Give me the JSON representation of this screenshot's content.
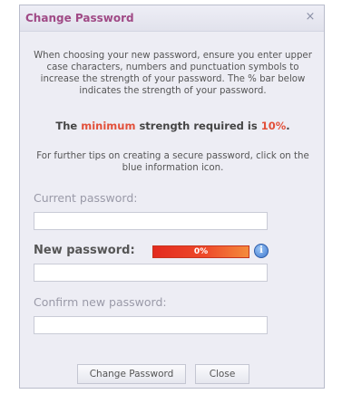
{
  "dialog": {
    "title": "Change Password",
    "close_glyph": "×",
    "intro_text": "When choosing your new password, ensure you enter upper case characters, numbers and punctuation symbols to increase the strength of your password. The % bar below indicates the strength of your password.",
    "strength_prefix": "The",
    "strength_word": "minimum",
    "strength_middle": "strength required is",
    "strength_value": "10%",
    "strength_suffix": ".",
    "tips_text": "For further tips on creating a secure password, click on the blue information icon."
  },
  "form": {
    "current_label": "Current password:",
    "current_value": "",
    "new_label": "New password:",
    "new_value": "",
    "confirm_label": "Confirm new password:",
    "confirm_value": ""
  },
  "meter": {
    "value_text": "0%",
    "value_percent": 0
  },
  "icons": {
    "info": "information-icon",
    "close": "close-icon"
  },
  "buttons": {
    "change_label": "Change Password",
    "close_label": "Close"
  },
  "colors": {
    "title": "#a04a86",
    "strength_highlight": "#e2503a",
    "meter": "#e32b1f",
    "info": "#3f78cf"
  }
}
